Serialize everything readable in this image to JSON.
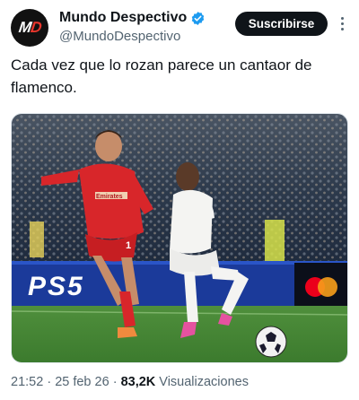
{
  "author": {
    "avatar_text_m": "M",
    "avatar_text_d": "D",
    "display_name": "Mundo Despectivo",
    "handle": "@MundoDespectivo",
    "verified": true
  },
  "actions": {
    "subscribe_label": "Suscribirse",
    "more_icon": "more-vertical-icon"
  },
  "tweet": {
    "text": "Cada vez que lo rozan parece un cantaor de flamenco."
  },
  "media": {
    "ad_board_text": "PS5",
    "jersey_sponsor": "Emirates",
    "player_number": "1"
  },
  "meta": {
    "time": "21:52",
    "sep1": " · ",
    "date": "25 feb 26",
    "sep2": " · ",
    "views": "83,2K",
    "views_label": " Visualizaciones"
  },
  "colors": {
    "brand_dark": "#0f1419",
    "secondary_text": "#536471",
    "verified_blue": "#1d9bf0",
    "avatar_red": "#e8362c"
  }
}
